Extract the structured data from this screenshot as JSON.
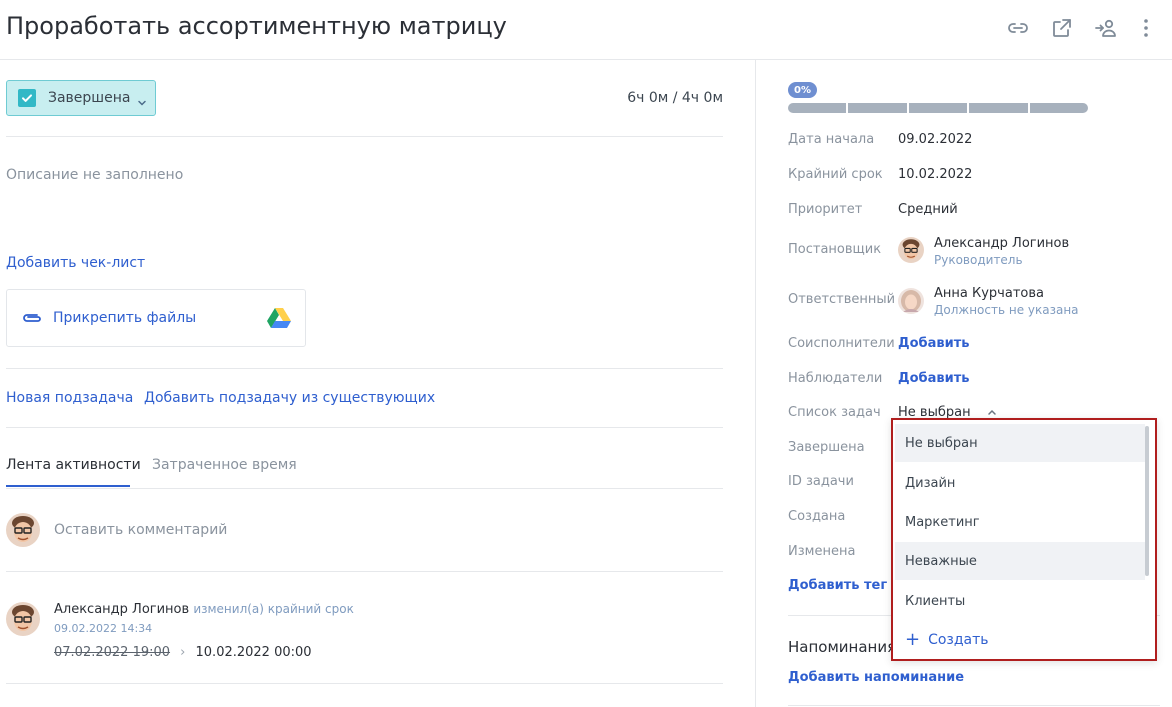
{
  "header": {
    "title": "Проработать ассортиментную матрицу",
    "icons": [
      "link-icon",
      "open-external-icon",
      "assign-user-icon",
      "more-vertical-icon"
    ]
  },
  "task": {
    "status_label": "Завершена",
    "time": "6ч 0м / 4ч 0м",
    "description_placeholder": "Описание не заполнено",
    "add_checklist": "Добавить чек-лист",
    "attach_files": "Прикрепить файлы",
    "new_subtask": "Новая подзадача",
    "add_existing_subtask": "Добавить подзадачу из существующих"
  },
  "tabs": {
    "activity": "Лента активности",
    "time_spent": "Затраченное время"
  },
  "comment": {
    "placeholder": "Оставить комментарий"
  },
  "activity": [
    {
      "author": "Александр Логинов",
      "action": "изменил(а) крайний срок",
      "timestamp": "09.02.2022 14:34",
      "old_value": "07.02.2022 19:00",
      "separator": "›",
      "new_value": "10.02.2022 00:00"
    }
  ],
  "panel": {
    "progress_label": "0%",
    "progress": 0,
    "start_date_label": "Дата начала",
    "start_date": "09.02.2022",
    "deadline_label": "Крайний срок",
    "deadline": "10.02.2022",
    "priority_label": "Приоритет",
    "priority": "Средний",
    "author_label": "Постановщик",
    "author_name": "Александр Логинов",
    "author_role": "Руководитель",
    "assignee_label": "Ответственный",
    "assignee_name": "Анна Курчатова",
    "assignee_role": "Должность не указана",
    "coexecutors_label": "Соисполнители",
    "coexecutors_add": "Добавить",
    "observers_label": "Наблюдатели",
    "observers_add": "Добавить",
    "tasklist_label": "Список задач",
    "tasklist_value": "Не выбран",
    "completed_label": "Завершена",
    "id_label": "ID задачи",
    "created_label": "Создана",
    "modified_label": "Изменена",
    "add_tag": "Добавить тег",
    "reminders_title": "Напоминания",
    "add_reminder": "Добавить напоминание"
  },
  "dropdown": {
    "options": [
      "Не выбран",
      "Дизайн",
      "Маркетинг",
      "Неважные",
      "Клиенты"
    ],
    "create_label": "Создать"
  },
  "colors": {
    "accent": "#2f5fcf",
    "status_bg": "#c8eef0",
    "status_check": "#32b8c6",
    "highlight_border": "#b01e1e"
  }
}
